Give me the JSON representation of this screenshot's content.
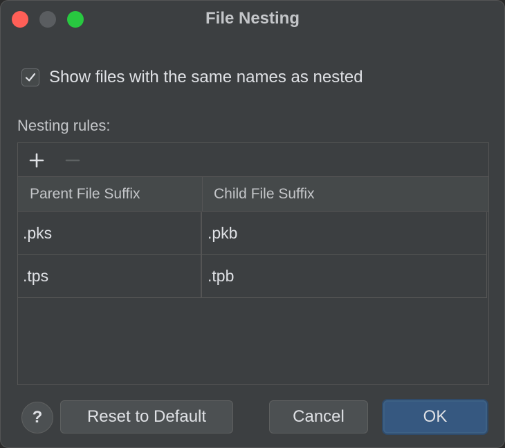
{
  "window": {
    "title": "File Nesting"
  },
  "options": {
    "show_same_names_label": "Show files with the same names as nested",
    "show_same_names_checked": true
  },
  "rules": {
    "section_label": "Nesting rules:",
    "add_symbol": "+",
    "remove_symbol": "−",
    "columns": [
      "Parent File Suffix",
      "Child File Suffix"
    ],
    "rows": [
      {
        "parent": ".pks",
        "child": ".pkb"
      },
      {
        "parent": ".tps",
        "child": ".tpb"
      }
    ]
  },
  "footer": {
    "help_label": "?",
    "reset_label": "Reset to Default",
    "cancel_label": "Cancel",
    "ok_label": "OK"
  },
  "colors": {
    "background": "#3c3f41",
    "accent_button": "#365880",
    "close": "#ff5f57",
    "minimize": "#5a5d60",
    "zoom": "#28c840"
  }
}
